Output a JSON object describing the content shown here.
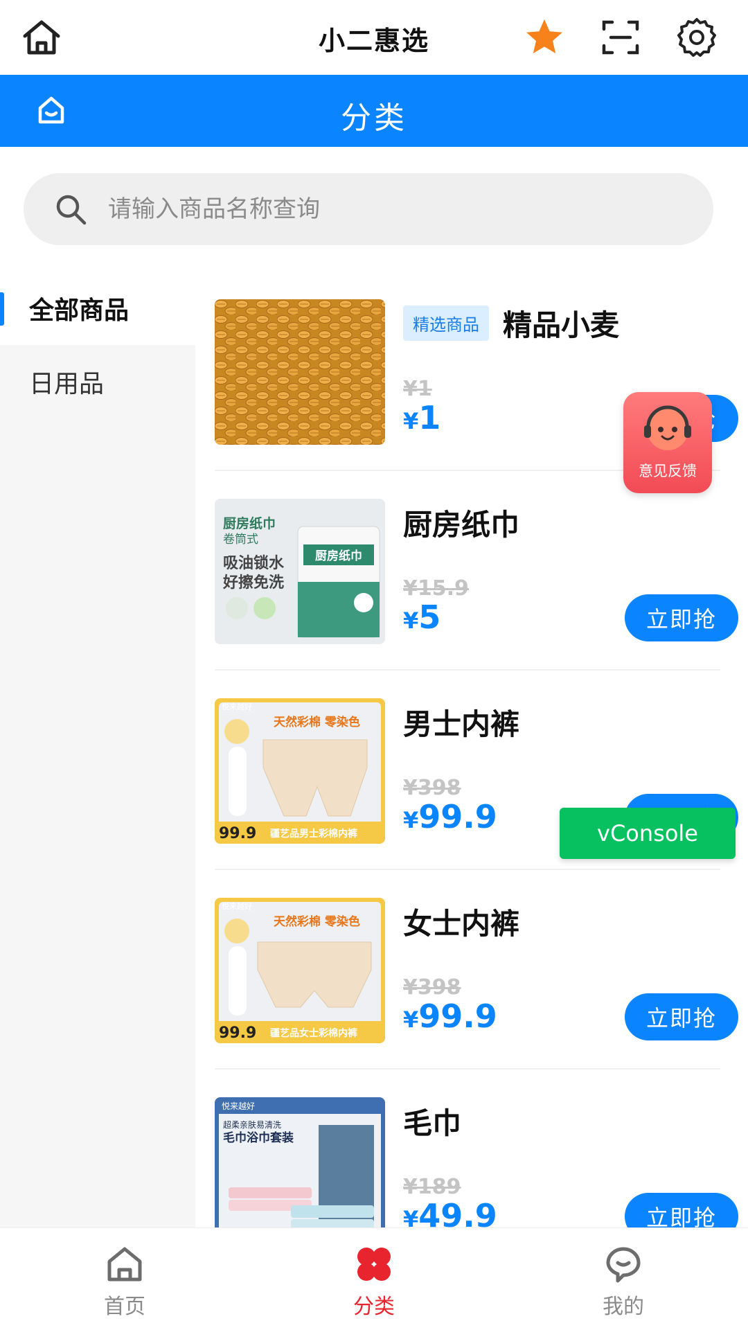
{
  "topbar": {
    "title": "小二惠选"
  },
  "header": {
    "title": "分类"
  },
  "search": {
    "placeholder": "请输入商品名称查询"
  },
  "categories": [
    {
      "label": "全部商品",
      "active": true
    },
    {
      "label": "日用品",
      "active": false
    }
  ],
  "products": [
    {
      "badge": "精选商品",
      "name": "精品小麦",
      "orig_price": "¥1",
      "currency": "¥",
      "price": "1",
      "button": "立即抢"
    },
    {
      "badge": "",
      "name": "厨房纸巾",
      "orig_price": "¥15.9",
      "currency": "¥",
      "price": "5",
      "button": "立即抢"
    },
    {
      "badge": "",
      "name": "男士内裤",
      "orig_price": "¥398",
      "currency": "¥",
      "price": "99.9",
      "button": "立即抢"
    },
    {
      "badge": "",
      "name": "女士内裤",
      "orig_price": "¥398",
      "currency": "¥",
      "price": "99.9",
      "button": "立即抢"
    },
    {
      "badge": "",
      "name": "毛巾",
      "orig_price": "¥189",
      "currency": "¥",
      "price": "49.9",
      "button": "立即抢"
    }
  ],
  "thumb_text": {
    "p1": {
      "line1": "厨房纸巾",
      "line2": "卷筒式",
      "line3": "吸油锁水",
      "line4": "好擦免洗",
      "pack": "厨房纸巾"
    },
    "p2": {
      "tag": "悦来越好",
      "headline": "天然彩棉 零染色",
      "price_tag": "99.9",
      "foot": "疆艺品男士彩棉内裤"
    },
    "p3": {
      "tag": "悦来越好",
      "headline": "天然彩棉 零染色",
      "price_tag": "99.9",
      "foot": "疆艺品女士彩棉内裤"
    },
    "p4": {
      "tag": "悦来越好",
      "line1": "超柔亲肤易清洗",
      "line2": "毛巾浴巾套装"
    }
  },
  "feedback": {
    "label": "意见反馈"
  },
  "vconsole": {
    "label": "vConsole"
  },
  "tabbar": [
    {
      "label": "首页",
      "icon": "home-icon",
      "active": false
    },
    {
      "label": "分类",
      "icon": "category-icon",
      "active": true
    },
    {
      "label": "我的",
      "icon": "profile-icon",
      "active": false
    }
  ],
  "colors": {
    "primary": "#0a84ff",
    "accent": "#e8242f",
    "star": "#f7821b",
    "vconsole": "#07c160"
  }
}
